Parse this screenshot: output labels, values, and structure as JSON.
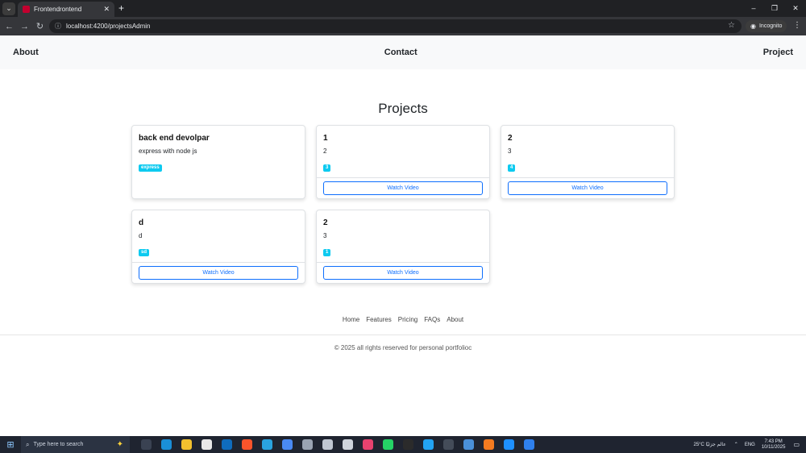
{
  "browser": {
    "tab_title": "Frontendrontend",
    "url": "localhost:4200/projectsAdmin",
    "incognito_label": "Incognito",
    "new_tab_glyph": "+",
    "tab_close_glyph": "✕",
    "window_controls": [
      "–",
      "❐",
      "✕"
    ]
  },
  "nav": {
    "about": "About",
    "contact": "Contact",
    "project": "Project"
  },
  "page": {
    "title": "Projects"
  },
  "projects": [
    {
      "title": "back end devolpar",
      "description": "express with node js",
      "tag": "express",
      "has_video": false
    },
    {
      "title": "1",
      "description": "2",
      "tag": "3",
      "has_video": true,
      "video_label": "Watch Video"
    },
    {
      "title": "2",
      "description": "3",
      "tag": "4",
      "has_video": true,
      "video_label": "Watch Video"
    },
    {
      "title": "d",
      "description": "d",
      "tag": "sd",
      "has_video": true,
      "video_label": "Watch Video"
    },
    {
      "title": "2",
      "description": "3",
      "tag": "1",
      "has_video": true,
      "video_label": "Watch Video"
    }
  ],
  "footer": {
    "links": [
      "Home",
      "Features",
      "Pricing",
      "FAQs",
      "About"
    ],
    "copyright": "© 2025 all rights reserved for personal portfolioc"
  },
  "taskbar": {
    "search_placeholder": "Type here to search",
    "weather": "25°C عالم جزئيًا",
    "language": "ENG",
    "time": "7:43 PM",
    "date": "10/11/2025",
    "app_icons": [
      "task-view",
      "edge",
      "file-explorer",
      "store",
      "outlook",
      "brave",
      "telegram",
      "chrome",
      "app-a",
      "app-b",
      "shield",
      "jetbrains",
      "whatsapp",
      "terminal-dark",
      "vscode",
      "terminal",
      "calculator",
      "app-orange",
      "download",
      "app-blue"
    ],
    "app_colors": [
      "#3a4252",
      "#1a8fd8",
      "#f2c12e",
      "#e8e8e8",
      "#0f6cbd",
      "#fb542b",
      "#2aa3df",
      "#4a8af4",
      "#9aa3b2",
      "#c0c7d2",
      "#cfd4dc",
      "#e8426f",
      "#25d366",
      "#2b2b2b",
      "#23a3f2",
      "#444c59",
      "#4a90d9",
      "#f47b20",
      "#1e90ff",
      "#2f80ed"
    ]
  },
  "colors": {
    "badge": "#0dcaf0",
    "primary": "#0d6efd",
    "navbar_bg": "#f8f9fa"
  }
}
